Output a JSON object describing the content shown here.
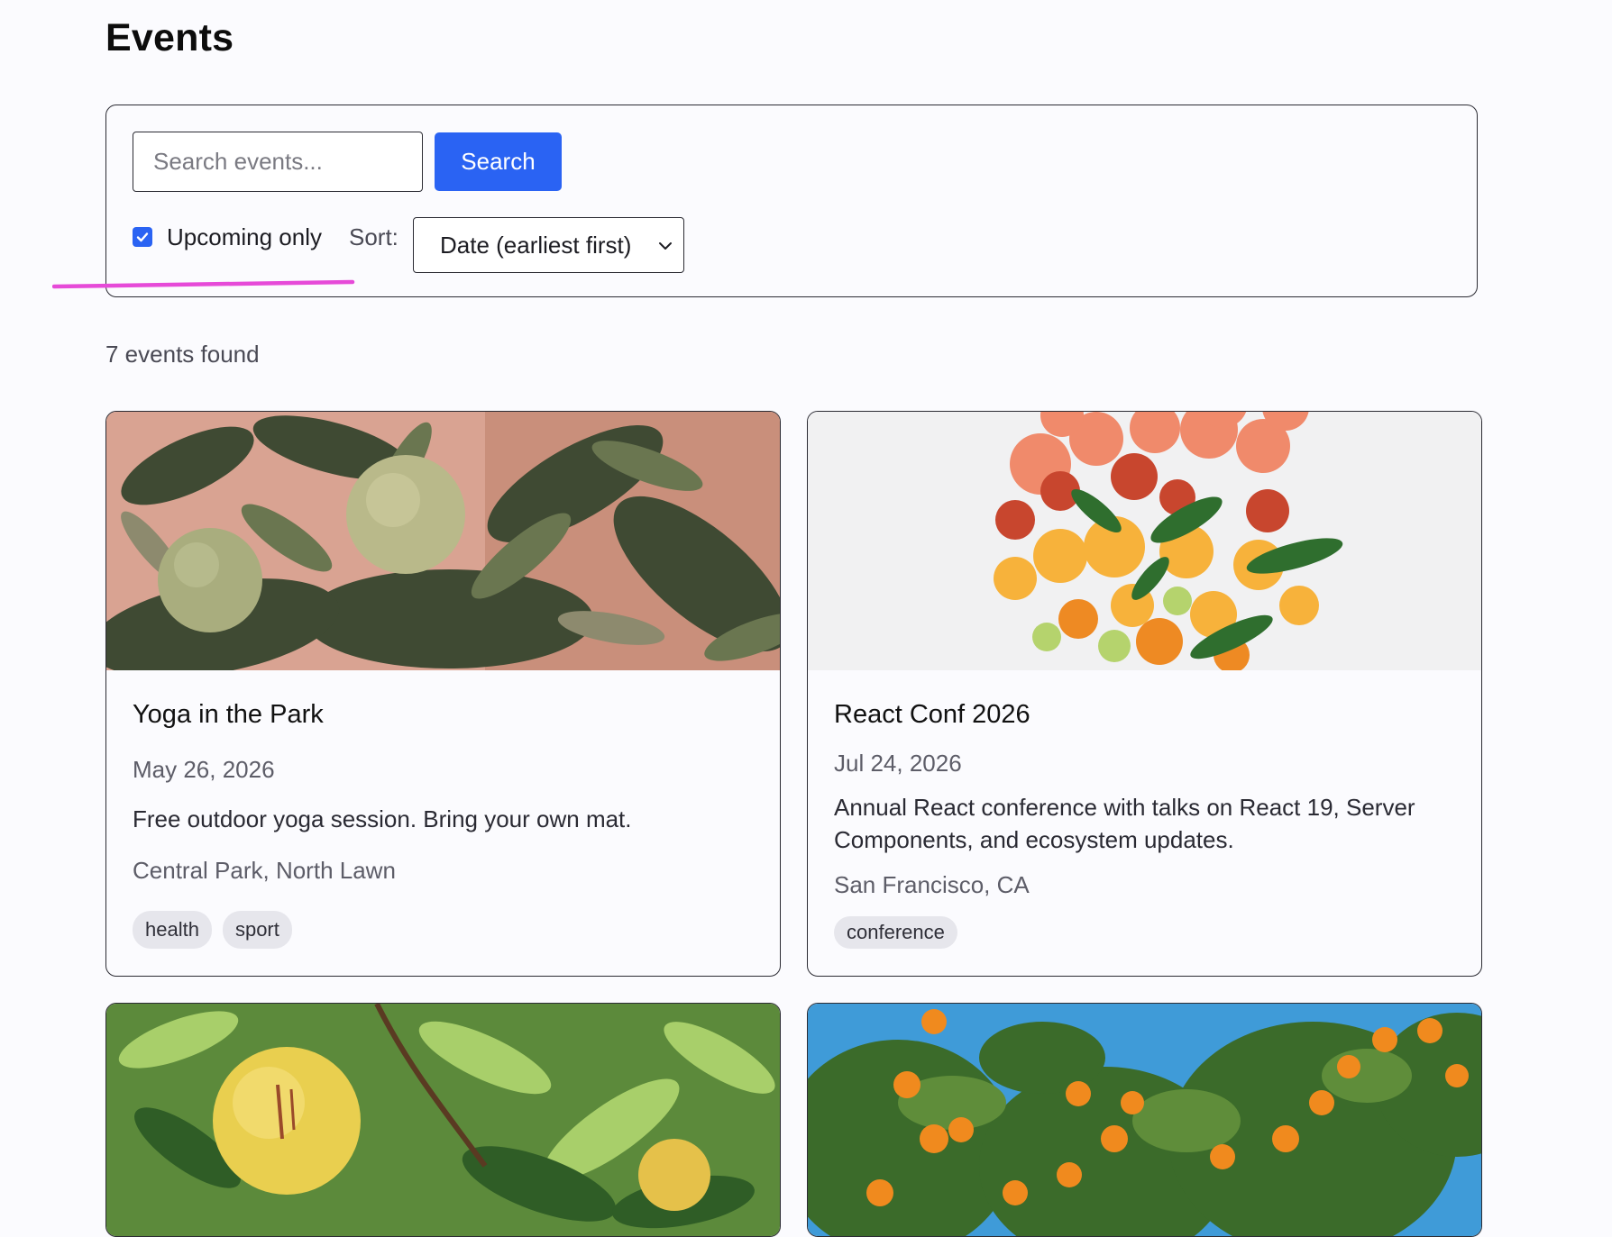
{
  "page": {
    "title": "Events"
  },
  "filters": {
    "search_placeholder": "Search events...",
    "search_value": "",
    "search_button": "Search",
    "upcoming_label": "Upcoming only",
    "upcoming_checked": true,
    "sort_label": "Sort:",
    "sort_value": "Date (earliest first)"
  },
  "results": {
    "count_text": "7 events found"
  },
  "events": [
    {
      "title": "Yoga in the Park",
      "date": "May 26, 2026",
      "description": "Free outdoor yoga session. Bring your own mat.",
      "location": "Central Park, North Lawn",
      "tags": [
        "health",
        "sport"
      ],
      "image": "green-citrus-tree-photo"
    },
    {
      "title": "React Conf 2026",
      "date": "Jul 24, 2026",
      "description": "Annual React conference with talks on React 19, Server Components, and ecosystem updates.",
      "location": "San Francisco, CA",
      "tags": [
        "conference"
      ],
      "image": "sliced-citrus-fruits-photo"
    },
    {
      "image": "yellow-grapefruit-tree-photo"
    },
    {
      "image": "orange-tree-blue-sky-photo"
    }
  ],
  "colors": {
    "primary": "#2a63f3",
    "annotation": "#e64ad8",
    "border": "#2b2b33",
    "tag_bg": "#e6e6ec"
  }
}
